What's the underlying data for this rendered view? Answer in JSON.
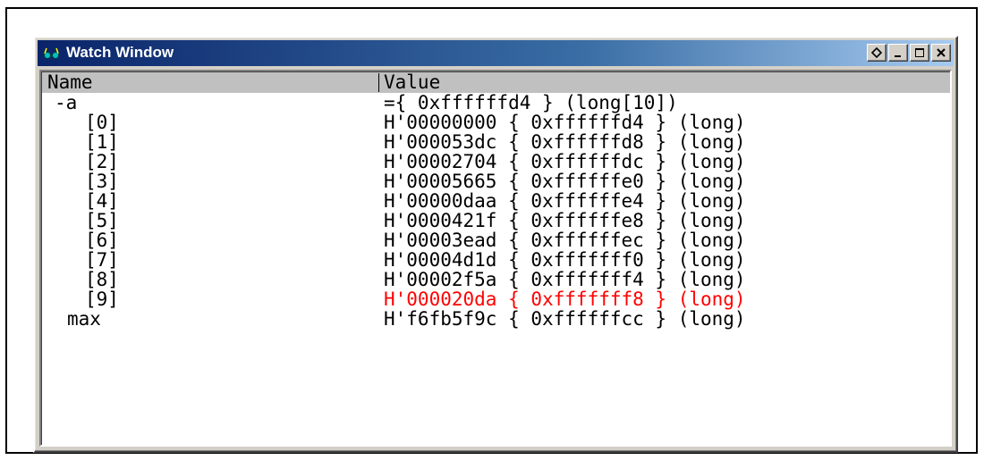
{
  "window": {
    "title": "Watch Window",
    "icon": "watch-glasses-icon",
    "buttons": [
      "float-icon",
      "minimize-icon",
      "maximize-icon",
      "close-icon"
    ]
  },
  "columns": {
    "name": "Name",
    "value": "Value"
  },
  "colors": {
    "title_start": "#0a246a",
    "title_end": "#a6caf0",
    "changed_value": "#ff0000"
  },
  "rows": [
    {
      "name": "-a",
      "value": "={ 0xffffffd4 } (long[10])"
    },
    {
      "name": "[0]",
      "value": "H'00000000 { 0xffffffd4 } (long)"
    },
    {
      "name": "[1]",
      "value": "H'000053dc { 0xffffffd8 } (long)"
    },
    {
      "name": "[2]",
      "value": "H'00002704 { 0xffffffdc } (long)"
    },
    {
      "name": "[3]",
      "value": "H'00005665 { 0xffffffe0 } (long)"
    },
    {
      "name": "[4]",
      "value": "H'00000daa { 0xffffffe4 } (long)"
    },
    {
      "name": "[5]",
      "value": "H'0000421f { 0xffffffe8 } (long)"
    },
    {
      "name": "[6]",
      "value": "H'00003ead { 0xffffffec } (long)"
    },
    {
      "name": "[7]",
      "value": "H'00004d1d { 0xfffffff0 } (long)"
    },
    {
      "name": "[8]",
      "value": "H'00002f5a { 0xfffffff4 } (long)"
    },
    {
      "name": "[9]",
      "value": "H'000020da { 0xfffffff8 } (long)"
    },
    {
      "name": "max",
      "value": "H'f6fb5f9c { 0xffffffcc } (long)"
    }
  ]
}
